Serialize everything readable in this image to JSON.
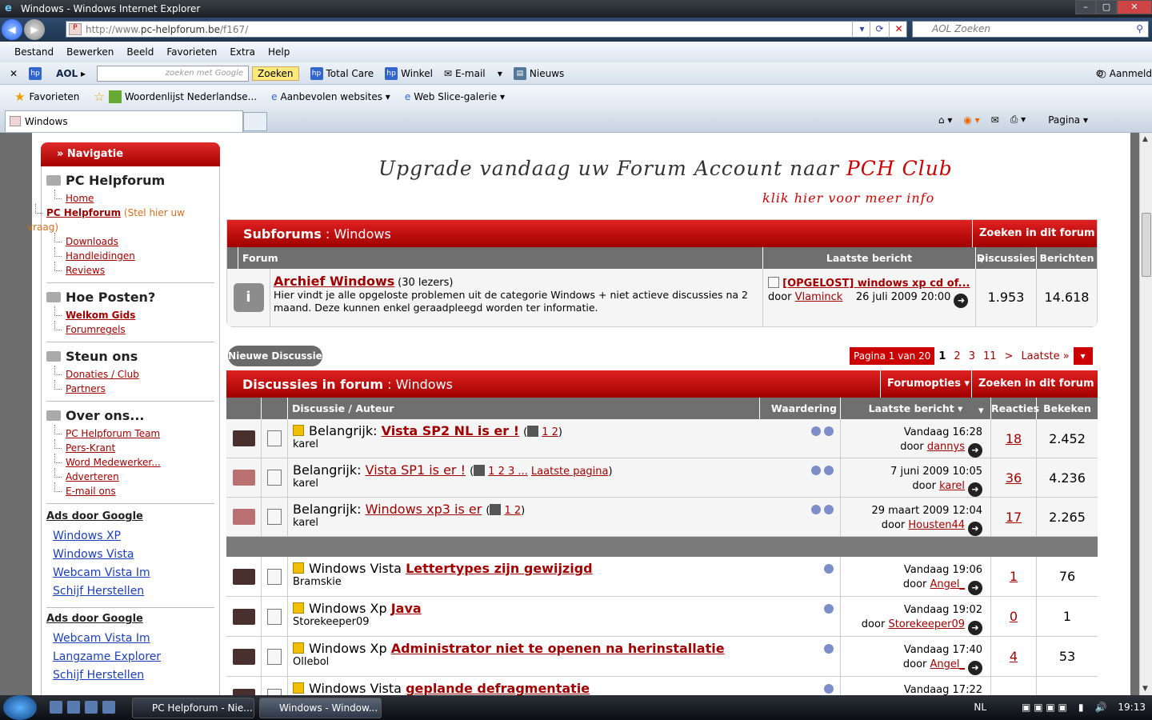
{
  "window": {
    "title": "Windows - Windows Internet Explorer"
  },
  "address": {
    "url_prefix": "http://www.",
    "url_domain": "pc-helpforum.be",
    "url_path": "/f167/",
    "search_placeholder": "AOL Zoeken"
  },
  "menu": [
    "Bestand",
    "Bewerken",
    "Beeld",
    "Favorieten",
    "Extra",
    "Help"
  ],
  "toolbar": {
    "aol": "AOL",
    "google_placeholder": "zoeken met Google",
    "zoeken": "Zoeken",
    "total_care": "Total Care",
    "winkel": "Winkel",
    "email": "E-mail",
    "nieuws": "Nieuws",
    "aanmelden": "Aanmeld"
  },
  "favbar": {
    "favorieten": "Favorieten",
    "woordenlijst": "Woordenlijst Nederlandse...",
    "aanbevolen": "Aanbevolen websites",
    "webslice": "Web Slice-galerie"
  },
  "tab": {
    "title": "Windows"
  },
  "cmd": {
    "pagina": "Pagina"
  },
  "sidebar": {
    "nav_title": "» Navigatie",
    "s1": {
      "title": "PC Helpforum",
      "home": "Home",
      "pch": "PC Helpforum",
      "pch_note": " (Stel hier uw vraag)",
      "downloads": "Downloads",
      "handleidingen": "Handleidingen",
      "reviews": "Reviews"
    },
    "s2": {
      "title": "Hoe Posten?",
      "welkom": "Welkom Gids",
      "regels": "Forumregels"
    },
    "s3": {
      "title": "Steun ons",
      "donaties": "Donaties / Club",
      "partners": "Partners"
    },
    "s4": {
      "title": "Over ons...",
      "team": "PC Helpforum Team",
      "pers": "Pers-Krant",
      "word": "Word Medewerker...",
      "adverteren": "Adverteren",
      "email": "E-mail ons"
    },
    "ads1": {
      "title": "Ads door Google",
      "a1": "Windows XP",
      "a2": "Windows Vista",
      "a3": "Webcam Vista Im",
      "a4": "Schijf Herstellen"
    },
    "ads2": {
      "title": "Ads door Google",
      "a1": "Webcam Vista Im",
      "a2": "Langzame Explorer",
      "a3": "Schijf Herstellen"
    }
  },
  "banner": {
    "l1a": "Upgrade vandaag uw Forum Account naar ",
    "l1b": "PCH Club",
    "l2": "klik hier voor meer info"
  },
  "subforums": {
    "label": "Subforums",
    "name": "Windows",
    "search": "Zoeken in dit forum",
    "cols": {
      "forum": "Forum",
      "last": "Laatste bericht",
      "disc": "Discussies",
      "posts": "Berichten"
    },
    "row": {
      "title": "Archief Windows",
      "readers": "(30 lezers)",
      "desc": "Hier vindt je alle opgeloste problemen uit de categorie Windows + niet actieve discussies na 2 maand. Deze kunnen enkel geraadpleegd worden ter informatie.",
      "last_title": "[OPGELOST] windows xp cd of...",
      "door": "door",
      "last_user": "Vlaminck",
      "last_date": "26 juli 2009 20:00",
      "disc": "1.953",
      "posts": "14.618"
    }
  },
  "new_discussion": "Nieuwe Discussie",
  "pagination": {
    "label": "Pagina 1 van 20",
    "p1": "1",
    "p2": "2",
    "p3": "3",
    "p11": "11",
    "next": ">",
    "last": "Laatste »"
  },
  "threads_header": {
    "label": "Discussies in forum",
    "name": "Windows",
    "options": "Forumopties",
    "search": "Zoeken in dit forum",
    "cols": {
      "disc": "Discussie / Auteur",
      "rating": "Waardering",
      "last": "Laatste bericht",
      "replies": "Reacties",
      "views": "Bekeken"
    }
  },
  "sticky": [
    {
      "prefix": "Belangrijk:",
      "title": "Vista SP2 NL is er !",
      "pages": "1 2",
      "author": "karel",
      "date": "Vandaag 16:28",
      "user": "dannys",
      "replies": "18",
      "views": "2.452"
    },
    {
      "prefix": "Belangrijk:",
      "title": "Vista SP1 is er !",
      "pages": "1 2 3 ...",
      "lastpage": "Laatste pagina",
      "author": "karel",
      "date": "7 juni 2009 10:05",
      "user": "karel",
      "replies": "36",
      "views": "4.236"
    },
    {
      "prefix": "Belangrijk:",
      "title": "Windows xp3 is er",
      "pages": "1 2",
      "author": "karel",
      "date": "29 maart 2009 12:04",
      "user": "Housten44",
      "replies": "17",
      "views": "2.265"
    }
  ],
  "threads": [
    {
      "prefix": "Windows Vista",
      "title": "Lettertypes zijn gewijzigd",
      "author": "Bramskie",
      "date": "Vandaag 19:06",
      "user": "Angel_",
      "replies": "1",
      "views": "76"
    },
    {
      "prefix": "Windows Xp",
      "title": "Java",
      "author": "Storekeeper09",
      "date": "Vandaag 19:02",
      "user": "Storekeeper09",
      "replies": "0",
      "views": "1"
    },
    {
      "prefix": "Windows Xp",
      "title": "Administrator niet te openen na herinstallatie",
      "author": "Ollebol",
      "date": "Vandaag 17:40",
      "user": "Angel_",
      "replies": "4",
      "views": "53"
    },
    {
      "prefix": "Windows Vista",
      "title": "geplande defragmentatie",
      "author": "",
      "date": "Vandaag 17:22",
      "user": "",
      "replies": "",
      "views": ""
    }
  ],
  "taskbar": {
    "t1": "PC Helpforum - Nie...",
    "t2": "Windows - Window...",
    "lang": "NL",
    "time": "19:13"
  }
}
